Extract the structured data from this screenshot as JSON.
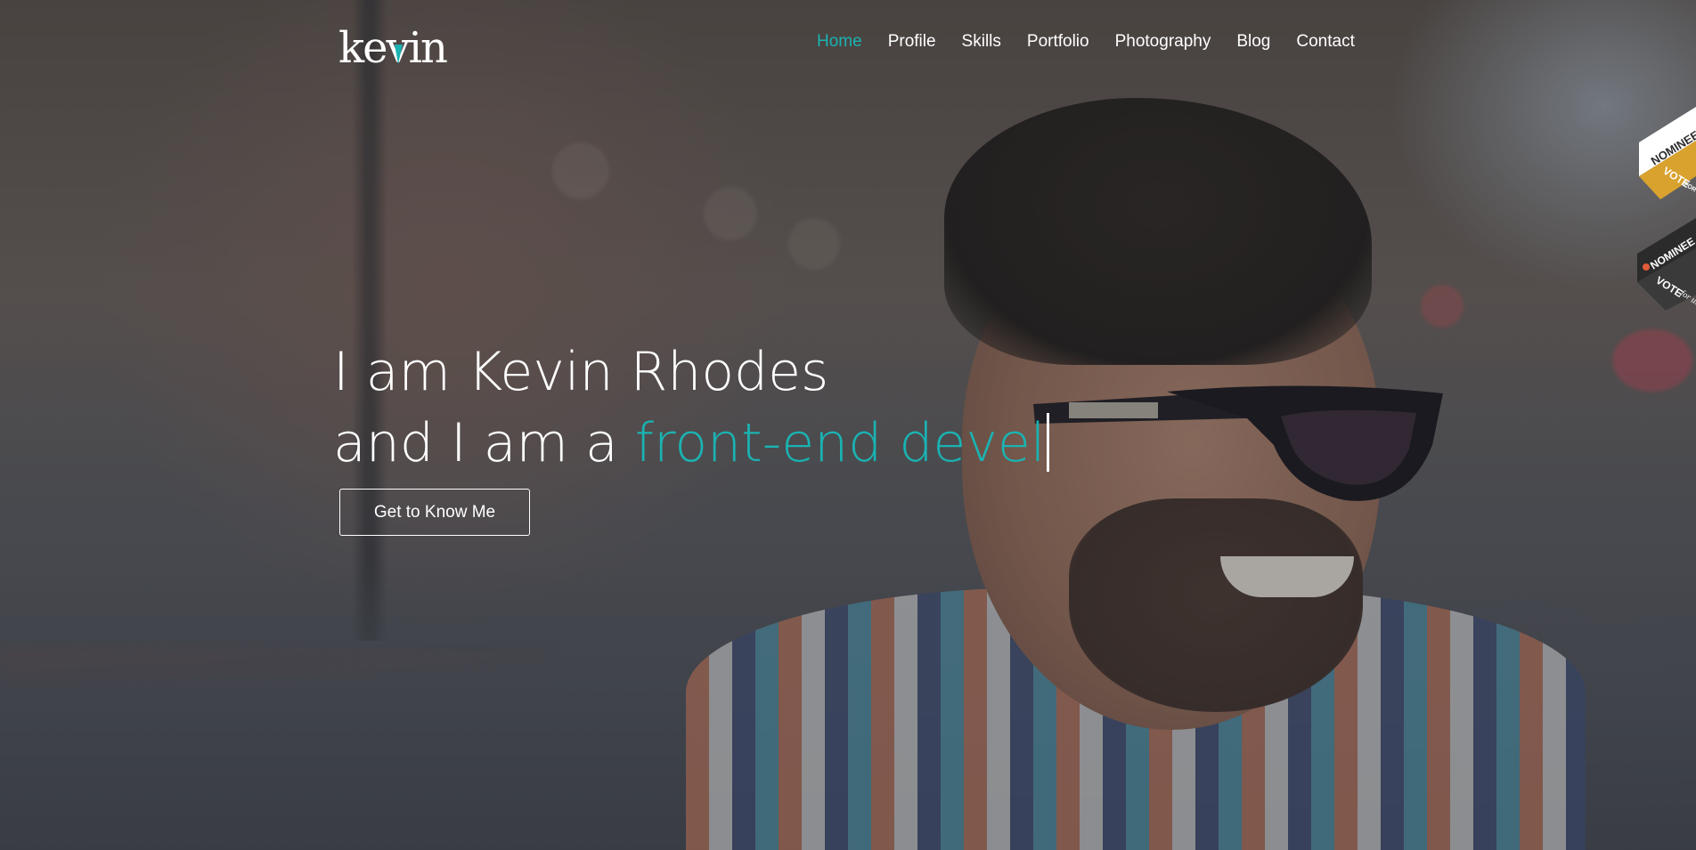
{
  "site": {
    "logo_text": "kevin"
  },
  "nav": {
    "items": [
      {
        "label": "Home",
        "active": true
      },
      {
        "label": "Profile",
        "active": false
      },
      {
        "label": "Skills",
        "active": false
      },
      {
        "label": "Portfolio",
        "active": false
      },
      {
        "label": "Photography",
        "active": false
      },
      {
        "label": "Blog",
        "active": false
      },
      {
        "label": "Contact",
        "active": false
      }
    ]
  },
  "hero": {
    "line1": "I am Kevin Rhodes",
    "line2_prefix": "and I am a ",
    "line2_typed": "front-end devel",
    "cta_label": "Get to Know Me"
  },
  "ribbons": [
    {
      "top": "NOMINEE",
      "bottom_main": "VOTE",
      "bottom_small": "FOR US"
    },
    {
      "top": "NOMINEE",
      "bottom_main": "VOTE",
      "bottom_small": "for us"
    }
  ],
  "colors": {
    "accent": "#1ab3b2",
    "text": "#ffffff",
    "ribbon_gold": "#d9a22e",
    "ribbon_dark": "#2b2b2b"
  },
  "icons": {
    "logo": "kevin-logo-icon",
    "cursor": "text-cursor-icon"
  }
}
